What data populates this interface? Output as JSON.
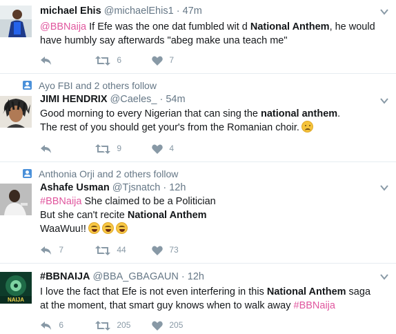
{
  "tweets": [
    {
      "context": "",
      "name": "michael Ehis",
      "handle": "@michaelEhis1",
      "sep": "·",
      "time": "47m",
      "segments": [
        {
          "t": "@BBNaija",
          "s": "link"
        },
        {
          "t": " If Efe was the one dat fumbled wit d ",
          "s": "plain"
        },
        {
          "t": "National Anthem",
          "s": "bold"
        },
        {
          "t": ", he would have humbly say afterwards \"abeg make una teach me\"",
          "s": "plain"
        }
      ],
      "retweets": "6",
      "likes": "7",
      "avatar": "avatar-michael"
    },
    {
      "context": "Ayo FBI and 2 others follow",
      "name": "JIMI HENDRIX",
      "handle": "@Caeles_",
      "sep": "·",
      "time": "54m",
      "segments": [
        {
          "t": "Good morning to every Nigerian that can sing the ",
          "s": "plain"
        },
        {
          "t": "national anthem",
          "s": "bold"
        },
        {
          "t": ".",
          "s": "plain"
        },
        {
          "t": "",
          "s": "br"
        },
        {
          "t": "The rest of you should get your's from the Romanian choir.",
          "s": "plain"
        },
        {
          "t": "sad",
          "s": "emoji"
        }
      ],
      "retweets": "9",
      "likes": "4",
      "avatar": "avatar-jimi"
    },
    {
      "context": "Anthonia Orji and 2 others follow",
      "name": "Ashafe Usman",
      "handle": "@Tjsnatch",
      "sep": "·",
      "time": "12h",
      "segments": [
        {
          "t": "#BBNaija",
          "s": "link"
        },
        {
          "t": " She claimed to be a Politician",
          "s": "plain"
        },
        {
          "t": "",
          "s": "br"
        },
        {
          "t": "But she can't recite ",
          "s": "plain"
        },
        {
          "t": "National Anthem",
          "s": "bold"
        },
        {
          "t": "",
          "s": "br"
        },
        {
          "t": "WaaWuu!!",
          "s": "plain"
        },
        {
          "t": "tear",
          "s": "emoji"
        },
        {
          "t": "tear",
          "s": "emoji"
        },
        {
          "t": "tear",
          "s": "emoji"
        }
      ],
      "replies": "7",
      "retweets": "44",
      "likes": "73",
      "avatar": "avatar-ashafe"
    },
    {
      "context": "",
      "name": "#BBNAIJA",
      "handle": "@BBA_GBAGAUN",
      "sep": "·",
      "time": "12h",
      "segments": [
        {
          "t": "I love the fact that Efe is not even interfering in this ",
          "s": "plain"
        },
        {
          "t": "National Anthem",
          "s": "bold"
        },
        {
          "t": " saga at the moment, that smart guy knows when to walk away ",
          "s": "plain"
        },
        {
          "t": "#BBNaija",
          "s": "link"
        }
      ],
      "replies": "6",
      "retweets": "205",
      "likes": "205",
      "avatar": "avatar-bbnaija",
      "avatar_text": "NAIJA"
    }
  ]
}
